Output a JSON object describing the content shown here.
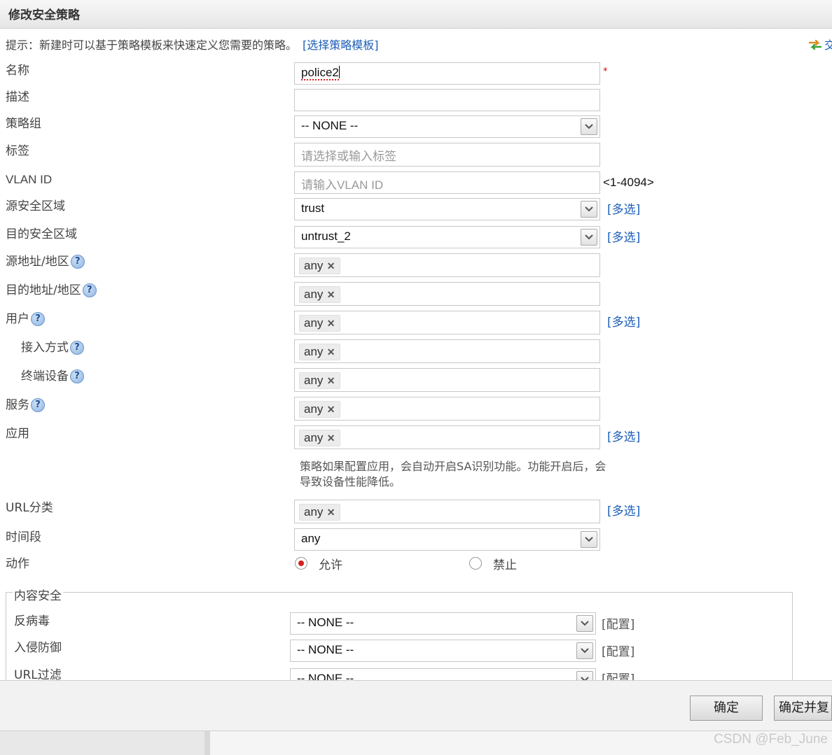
{
  "dialog": {
    "title": "修改安全策略"
  },
  "hint": {
    "text": "提示：新建时可以基于策略模板来快速定义您需要的策略。",
    "link": "[选择策略模板]",
    "swap_text": "交"
  },
  "form": {
    "name": {
      "label": "名称",
      "value": "police2",
      "required_mark": "*"
    },
    "description": {
      "label": "描述",
      "value": ""
    },
    "policy_group": {
      "label": "策略组",
      "value": "-- NONE --"
    },
    "tags": {
      "label": "标签",
      "placeholder": "请选择或输入标签"
    },
    "vlan": {
      "label": "VLAN ID",
      "placeholder": "请输入VLAN ID",
      "range": "<1-4094>"
    },
    "src_zone": {
      "label": "源安全区域",
      "value": "trust",
      "multi": "[多选]"
    },
    "dst_zone": {
      "label": "目的安全区域",
      "value": "untrust_2",
      "multi": "[多选]"
    },
    "src_addr": {
      "label": "源地址/地区",
      "chip": "any"
    },
    "dst_addr": {
      "label": "目的地址/地区",
      "chip": "any"
    },
    "user": {
      "label": "用户",
      "chip": "any",
      "multi": "[多选]"
    },
    "access_method": {
      "label": "接入方式",
      "chip": "any"
    },
    "terminal": {
      "label": "终端设备",
      "chip": "any"
    },
    "service": {
      "label": "服务",
      "chip": "any"
    },
    "application": {
      "label": "应用",
      "chip": "any",
      "multi": "[多选]",
      "note": "策略如果配置应用，会自动开启SA识别功能。功能开启后，会导致设备性能降低。"
    },
    "url_category": {
      "label": "URL分类",
      "chip": "any",
      "multi": "[多选]"
    },
    "time_range": {
      "label": "时间段",
      "value": "any"
    },
    "action": {
      "label": "动作",
      "options": [
        "允许",
        "禁止"
      ],
      "selected": "允许"
    },
    "help_glyph": "?",
    "remove_glyph": "✕"
  },
  "content_security": {
    "legend": "内容安全",
    "antivirus": {
      "label": "反病毒",
      "value": "-- NONE --",
      "config": "[配置]"
    },
    "ips": {
      "label": "入侵防御",
      "value": "-- NONE --",
      "config": "[配置]"
    },
    "url_filter": {
      "label": "URL过滤",
      "value": "-- NONE --",
      "config": "[配置]"
    }
  },
  "footer": {
    "ok": "确定",
    "ok_copy": "确定并复"
  },
  "watermark": "CSDN @Feb_June",
  "colors": {
    "link": "#1c5fb8",
    "required": "#dd0000",
    "radio_selected": "#d12020"
  },
  "icons": {
    "help": "question-circle-icon",
    "swap": "swap-arrows-icon",
    "dropdown": "chevron-down-icon",
    "remove": "close-icon"
  }
}
